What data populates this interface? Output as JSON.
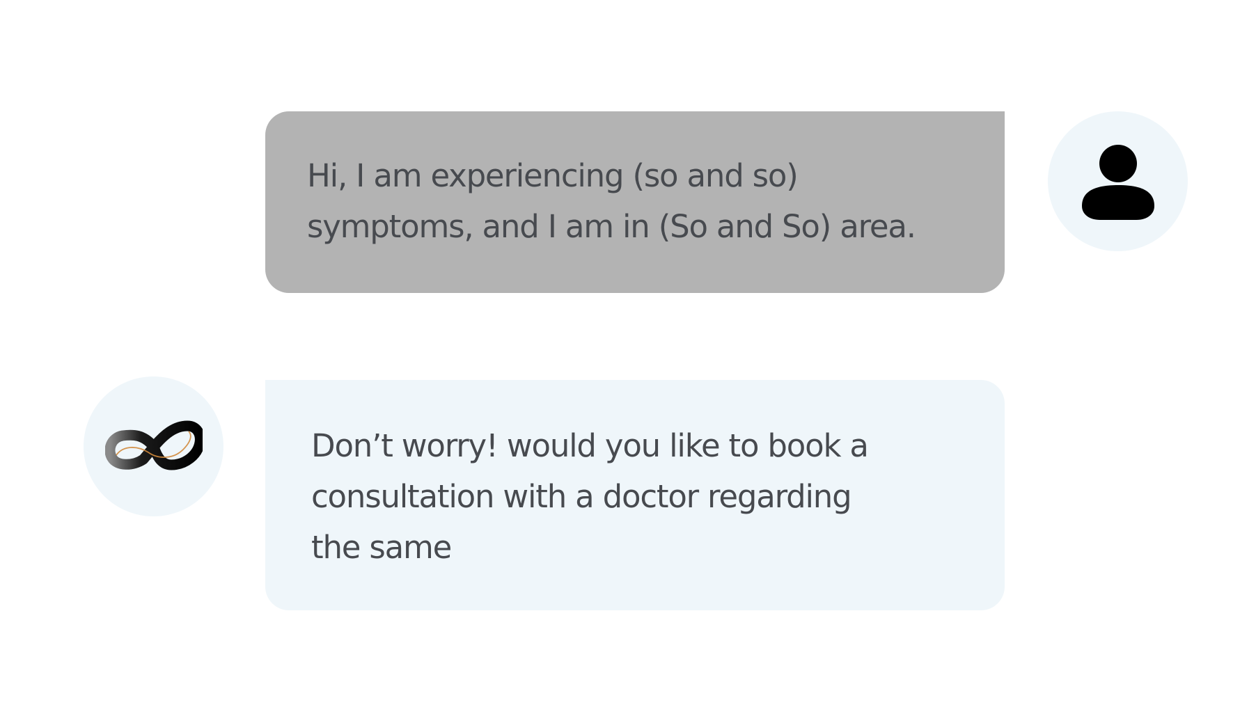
{
  "conversation": {
    "messages": [
      {
        "sender": "user",
        "text": "Hi, I am experiencing (so and so)\nsymptoms, and I am in (So and So) area."
      },
      {
        "sender": "assistant",
        "text": "Don’t worry! would you like to book a\nconsultation with a doctor regarding\nthe same"
      }
    ]
  },
  "avatars": {
    "user": {
      "icon": "person-icon"
    },
    "assistant": {
      "icon": "infinity-logo-icon"
    }
  },
  "colors": {
    "user_bubble": "#b3b3b3",
    "assistant_bubble": "#eff6fa",
    "avatar_background": "#eff6fa",
    "text": "#474a4f",
    "logo_accent": "#d08a3c"
  }
}
